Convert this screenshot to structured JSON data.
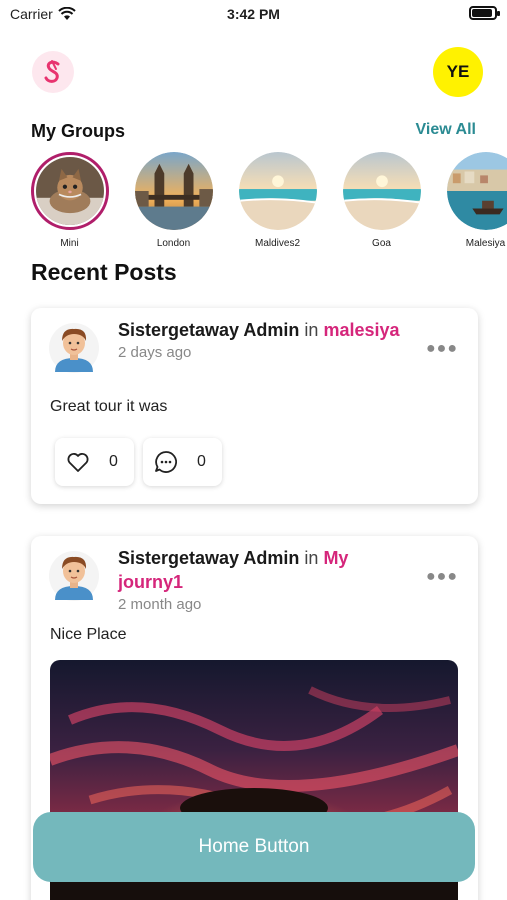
{
  "status_bar": {
    "carrier": "Carrier",
    "time": "3:42 PM",
    "battery_level": 0.9
  },
  "header": {
    "avatar_initials": "YE",
    "logo_letter": "S"
  },
  "groups": {
    "title": "My Groups",
    "view_all_label": "View All",
    "items": [
      {
        "label": "Mini",
        "image": "cat-photo",
        "active": true
      },
      {
        "label": "London",
        "image": "london-bridge-photo",
        "active": false
      },
      {
        "label": "Maldives2",
        "image": "beach-photo",
        "active": false
      },
      {
        "label": "Goa",
        "image": "beach-photo",
        "active": false
      },
      {
        "label": "Malesiya",
        "image": "harbor-photo",
        "active": false
      }
    ]
  },
  "recent_posts": {
    "title": "Recent Posts",
    "posts": [
      {
        "author": "Sistergetaway Admin",
        "in_word": "in",
        "group": "malesiya",
        "time": "2 days ago",
        "text": "Great tour it was",
        "likes": "0",
        "comments": "0"
      },
      {
        "author": "Sistergetaway Admin",
        "in_word": "in",
        "group": "My journy1",
        "time": "2 month ago",
        "text": "Nice Place",
        "image": "sunset-sky-photo"
      }
    ]
  },
  "footer": {
    "home_button_label": "Home Button"
  },
  "colors": {
    "accent_pink": "#d5267b",
    "teal": "#2b8b93",
    "home_button": "#74b8bc",
    "avatar_yellow": "#fff200"
  }
}
